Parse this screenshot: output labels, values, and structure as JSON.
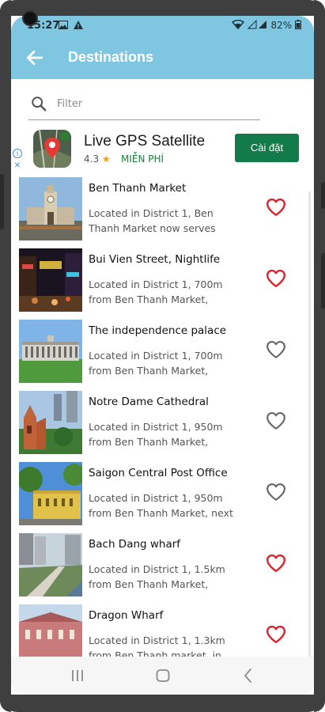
{
  "status_bar": {
    "time": "15:27",
    "notification_icons": [
      "image-icon",
      "warning-icon"
    ],
    "battery": "82%"
  },
  "app_bar": {
    "title": "Destinations",
    "back_icon": "arrow-left-icon",
    "color": "#7fc6e0"
  },
  "search": {
    "placeholder": "Filter",
    "value": ""
  },
  "ad": {
    "title": "Live GPS Satellite",
    "rating": "4.3",
    "price_label": "MIỄN PHÍ",
    "install_label": "Cài đặt",
    "install_color": "#137a4a"
  },
  "destinations": [
    {
      "name": "Ben Thanh Market",
      "desc": "Located in District 1, Ben Thanh Market now serves",
      "favorite": true
    },
    {
      "name": "Bui Vien Street, Nightlife",
      "desc": "Located in District 1, 700m from Ben Thanh Market,",
      "favorite": true
    },
    {
      "name": "The independence palace",
      "desc": "Located in District 1, 700m from Ben Thanh Market,",
      "favorite": false
    },
    {
      "name": "Notre Dame Cathedral",
      "desc": "Located in District 1, 950m from Ben Thanh Market,",
      "favorite": false
    },
    {
      "name": "Saigon Central Post Office",
      "desc": "Located in District 1, 950m from Ben Thanh Market, next",
      "favorite": false
    },
    {
      "name": "Bach Dang wharf",
      "desc": "Located in District 1, 1.5km from Ben Thanh Market,",
      "favorite": true
    },
    {
      "name": "Dragon Wharf",
      "desc": "Located in District 1, 1.3km from Ben Thanh market, in",
      "favorite": true
    }
  ],
  "colors": {
    "favorite": "#e0202a",
    "not_favorite": "#666666"
  }
}
